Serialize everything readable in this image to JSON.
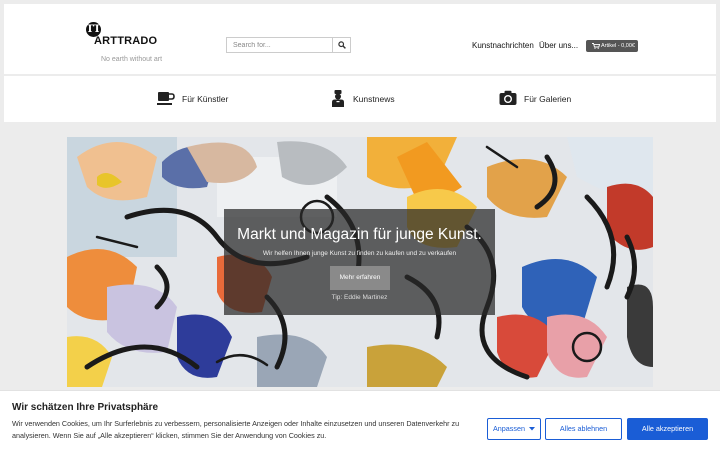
{
  "brand": {
    "mark": "TT",
    "name": "ARTTRADO",
    "tagline": "No earth without art"
  },
  "search": {
    "placeholder": "Search for...",
    "button_icon": "search-icon"
  },
  "topnav": {
    "items": [
      {
        "label": "Kunstnachrichten"
      },
      {
        "label": "Über uns..."
      }
    ],
    "cart": {
      "label": "Artikel - 0,00€",
      "icon": "cart-icon"
    }
  },
  "categories": [
    {
      "label": "Für Künstler",
      "icon": "coffee-cup-icon"
    },
    {
      "label": "Kunstnews",
      "icon": "artist-figure-icon"
    },
    {
      "label": "Für Galerien",
      "icon": "camera-icon"
    }
  ],
  "hero": {
    "title": "Markt und Magazin für junge Kunst.",
    "subtitle": "Wir helfen Ihnen junge Kunst zu finden zu kaufen und zu verkaufen",
    "button": "Mehr erfahren",
    "tip": "Tip: Eddie Martinez"
  },
  "cookie": {
    "title": "Wir schätzen Ihre Privatsphäre",
    "text": "Wir verwenden Cookies, um Ihr Surferlebnis zu verbessern, personalisierte Anzeigen oder Inhalte einzusetzen und unseren Datenverkehr zu analysieren. Wenn Sie auf „Alle akzeptieren“ klicken, stimmen Sie der Anwendung von Cookies zu.",
    "customize": "Anpassen",
    "reject": "Alles ablehnen",
    "accept": "Alle akzeptieren"
  },
  "colors": {
    "accent": "#1a5dd6",
    "cart_bg": "#555555",
    "overlay": "#282828"
  }
}
